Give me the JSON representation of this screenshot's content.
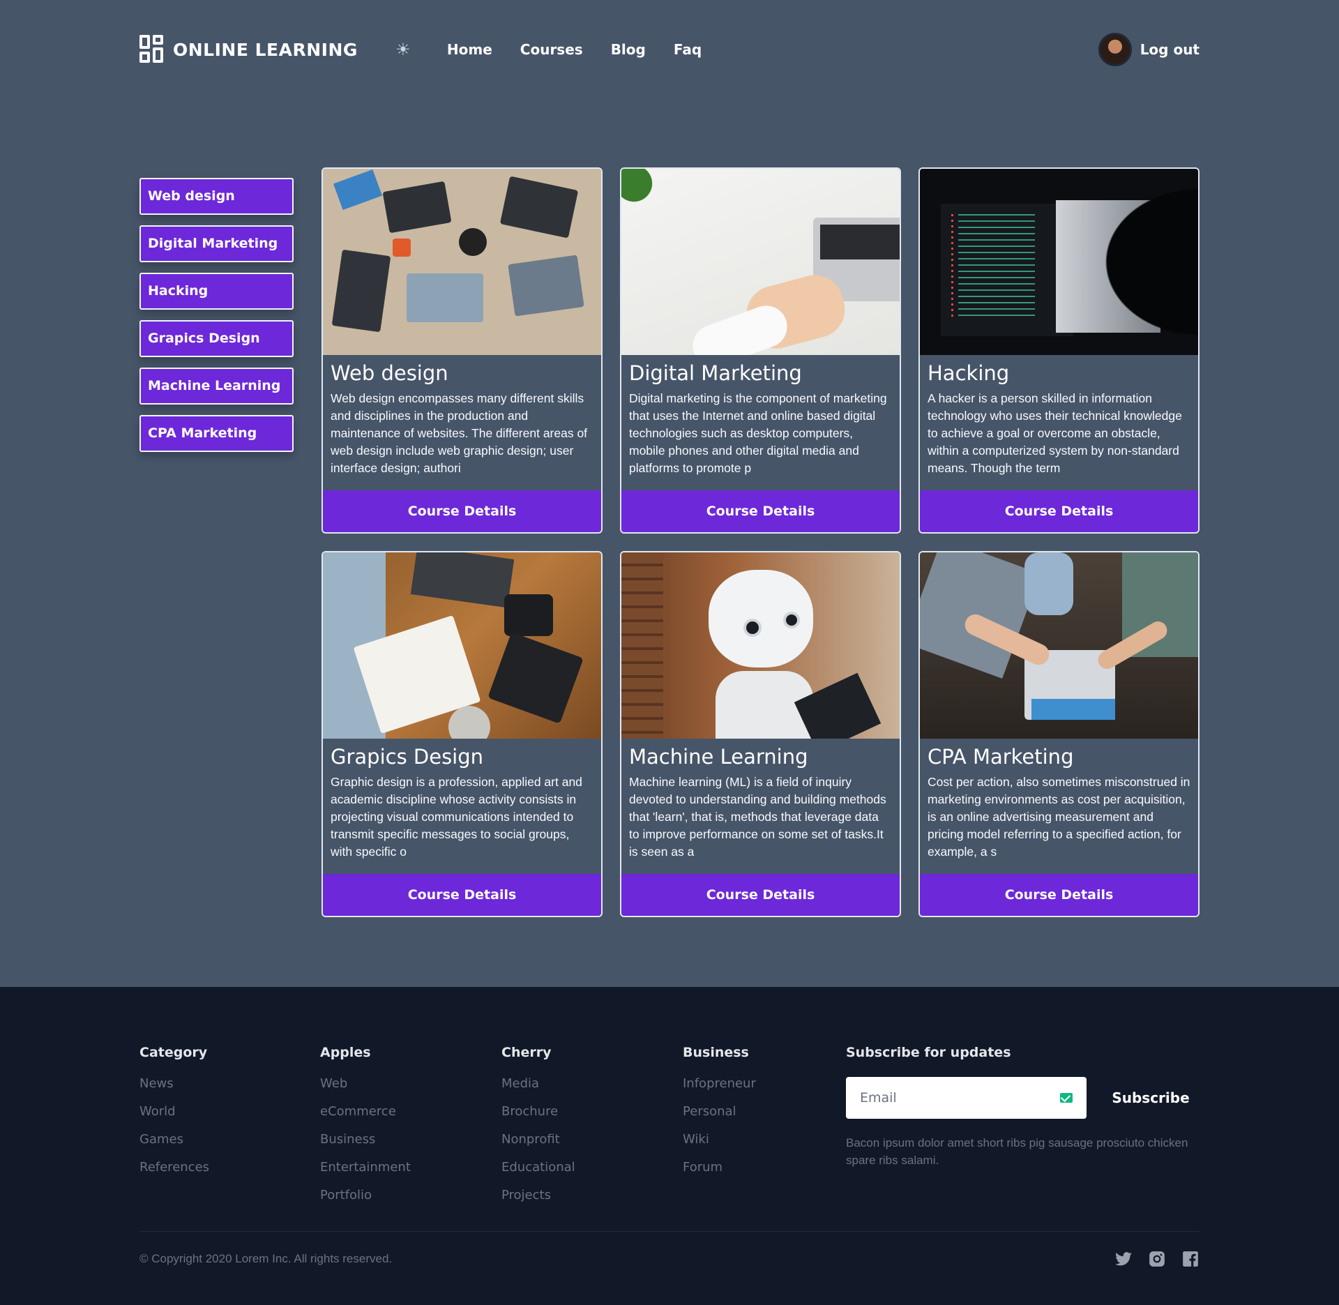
{
  "header": {
    "brand": "ONLINE LEARNING",
    "nav": [
      "Home",
      "Courses",
      "Blog",
      "Faq"
    ],
    "logout": "Log out"
  },
  "sidebar": {
    "items": [
      "Web design",
      "Digital Marketing",
      "Hacking",
      "Grapics Design",
      "Machine Learning",
      "CPA Marketing"
    ]
  },
  "courses": [
    {
      "title": "Web design",
      "text": "Web design encompasses many different skills and disciplines in the production and maintenance of websites. The different areas of web design include web graphic design; user interface design; authori",
      "button": "Course Details"
    },
    {
      "title": "Digital Marketing",
      "text": "Digital marketing is the component of marketing that uses the Internet and online based digital technologies such as desktop computers, mobile phones and other digital media and platforms to promote p",
      "button": "Course Details"
    },
    {
      "title": "Hacking",
      "text": "A hacker is a person skilled in information technology who uses their technical knowledge to achieve a goal or overcome an obstacle, within a computerized system by non-standard means. Though the term",
      "button": "Course Details"
    },
    {
      "title": "Grapics Design",
      "text": "Graphic design is a profession, applied art and academic discipline whose activity consists in projecting visual communications intended to transmit specific messages to social groups, with specific o",
      "button": "Course Details"
    },
    {
      "title": "Machine Learning",
      "text": "Machine learning (ML) is a field of inquiry devoted to understanding and building methods that 'learn', that is, methods that leverage data to improve performance on some set of tasks.It is seen as a",
      "button": "Course Details"
    },
    {
      "title": "CPA Marketing",
      "text": "Cost per action, also sometimes misconstrued in marketing environments as cost per acquisition, is an online advertising measurement and pricing model referring to a specified action, for example, a s",
      "button": "Course Details"
    }
  ],
  "footer": {
    "columns": [
      {
        "heading": "Category",
        "links": [
          "News",
          "World",
          "Games",
          "References"
        ]
      },
      {
        "heading": "Apples",
        "links": [
          "Web",
          "eCommerce",
          "Business",
          "Entertainment",
          "Portfolio"
        ]
      },
      {
        "heading": "Cherry",
        "links": [
          "Media",
          "Brochure",
          "Nonprofit",
          "Educational",
          "Projects"
        ]
      },
      {
        "heading": "Business",
        "links": [
          "Infopreneur",
          "Personal",
          "Wiki",
          "Forum"
        ]
      }
    ],
    "subscribe": {
      "heading": "Subscribe for updates",
      "placeholder": "Email",
      "button": "Subscribe",
      "note": "Bacon ipsum dolor amet short ribs pig sausage prosciuto chicken spare ribs salami."
    },
    "copyright": "© Copyright 2020 Lorem Inc. All rights reserved.",
    "socials": [
      "twitter-icon",
      "instagram-icon",
      "facebook-icon"
    ]
  },
  "colors": {
    "page_bg": "#475569",
    "accent": "#6d28d9",
    "footer_bg": "#111827"
  }
}
